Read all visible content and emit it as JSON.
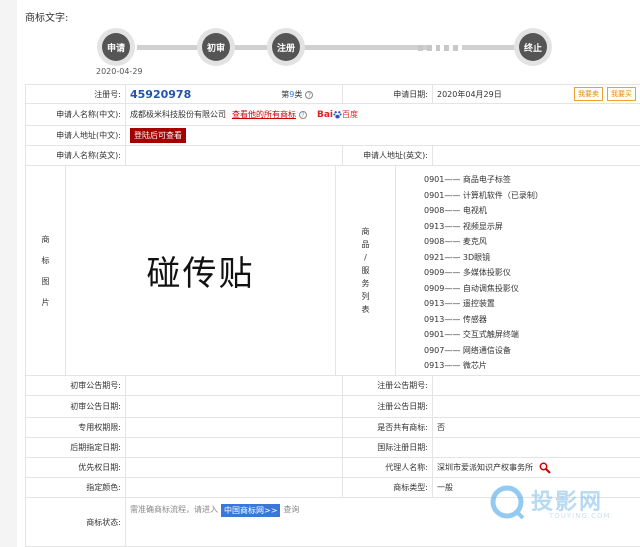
{
  "section_title": "商标文字:",
  "progress": {
    "steps": [
      "申请",
      "初审",
      "注册",
      "终止"
    ],
    "date": "2020-04-29"
  },
  "rows": {
    "reg_no_label": "注册号:",
    "reg_no": "45920978",
    "class_prefix": "第",
    "class_num": "9",
    "class_suffix": "类",
    "apply_date_label": "申请日期:",
    "apply_date": "2020年04月29日",
    "buy_btn1": "我要卖",
    "buy_btn2": "我要买",
    "applicant_cn_label": "申请人名称(中文):",
    "applicant_cn": "成都极米科技股份有限公司",
    "all_marks_link": "查看他的所有商标",
    "baidu_label": "百度",
    "addr_cn_label": "申请人地址(中文):",
    "addr_cn_btn": "登陆后可查看",
    "applicant_en_label": "申请人名称(英文):",
    "addr_en_label": "申请人地址(英文):",
    "image_label": [
      "商",
      "标",
      "图",
      "片"
    ],
    "tm_text": "碰传贴",
    "goods_label": [
      "商",
      "品",
      "/",
      "服",
      "务",
      "列",
      "表"
    ],
    "goods": [
      "0901—— 商品电子标签",
      "0901—— 计算机软件（已录制）",
      "0908—— 电视机",
      "0913—— 视频显示屏",
      "0908—— 麦克风",
      "0921—— 3D眼镜",
      "0909—— 多媒体投影仪",
      "0909—— 自动调焦投影仪",
      "0913—— 遥控装置",
      "0913—— 传感器",
      "0901—— 交互式触屏终端",
      "0907—— 网络通信设备",
      "0913—— 微芯片"
    ],
    "prelim_no_label": "初审公告期号:",
    "reg_notice_no_label": "注册公告期号:",
    "prelim_date_label": "初审公告日期:",
    "reg_notice_date_label": "注册公告日期:",
    "exclusive_label": "专用权期限:",
    "shared_label": "是否共有商标:",
    "shared_value": "否",
    "later_date_label": "后期指定日期:",
    "intl_date_label": "国际注册日期:",
    "priority_label": "优先权日期:",
    "agent_label": "代理人名称:",
    "agent_value": "深圳市爱派知识产权事务所",
    "color_label": "指定颜色:",
    "type_label": "商标类型:",
    "type_value": "一般",
    "status_label": "商标状态:",
    "status_text1": "需准确商标流程，请进入",
    "status_tag": "中国商标网>>",
    "status_text2": "查询"
  },
  "watermark": {
    "text": "投影网",
    "sub": "TOUYING.COM"
  },
  "colors": {
    "accent_red": "#a50000",
    "reg_blue": "#2255aa",
    "step_dark": "#555555"
  }
}
